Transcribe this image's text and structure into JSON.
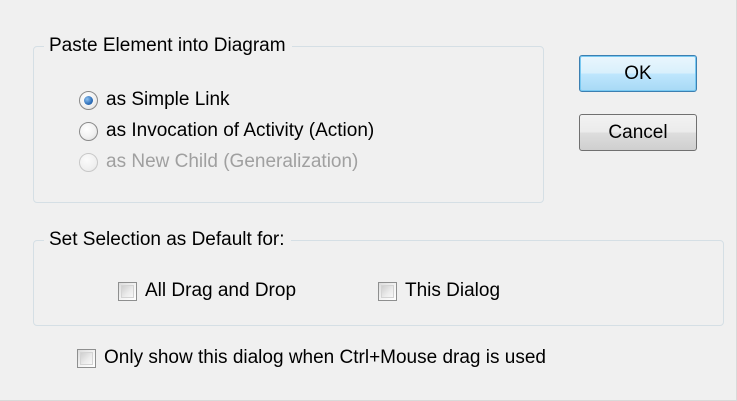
{
  "paste_group": {
    "legend": "Paste Element into Diagram",
    "options": [
      {
        "label": "as Simple Link",
        "state": "checked"
      },
      {
        "label": "as Invocation of Activity (Action)",
        "state": "unchecked"
      },
      {
        "label": "as New Child (Generalization)",
        "state": "disabled"
      }
    ]
  },
  "buttons": {
    "ok": "OK",
    "cancel": "Cancel"
  },
  "default_group": {
    "legend": "Set Selection as Default for:",
    "options": [
      {
        "label": "All Drag and Drop",
        "checked": false
      },
      {
        "label": "This Dialog",
        "checked": false
      }
    ]
  },
  "footer": {
    "only_show_label": "Only show this dialog when Ctrl+Mouse drag is used",
    "only_show_checked": false
  },
  "colors": {
    "dialog_background": "#f0f0f0",
    "group_border": "#d5dfe5",
    "default_button_border": "#3c7fb1",
    "disabled_text": "#a0a0a0",
    "radio_selected": "#2e6fba"
  }
}
